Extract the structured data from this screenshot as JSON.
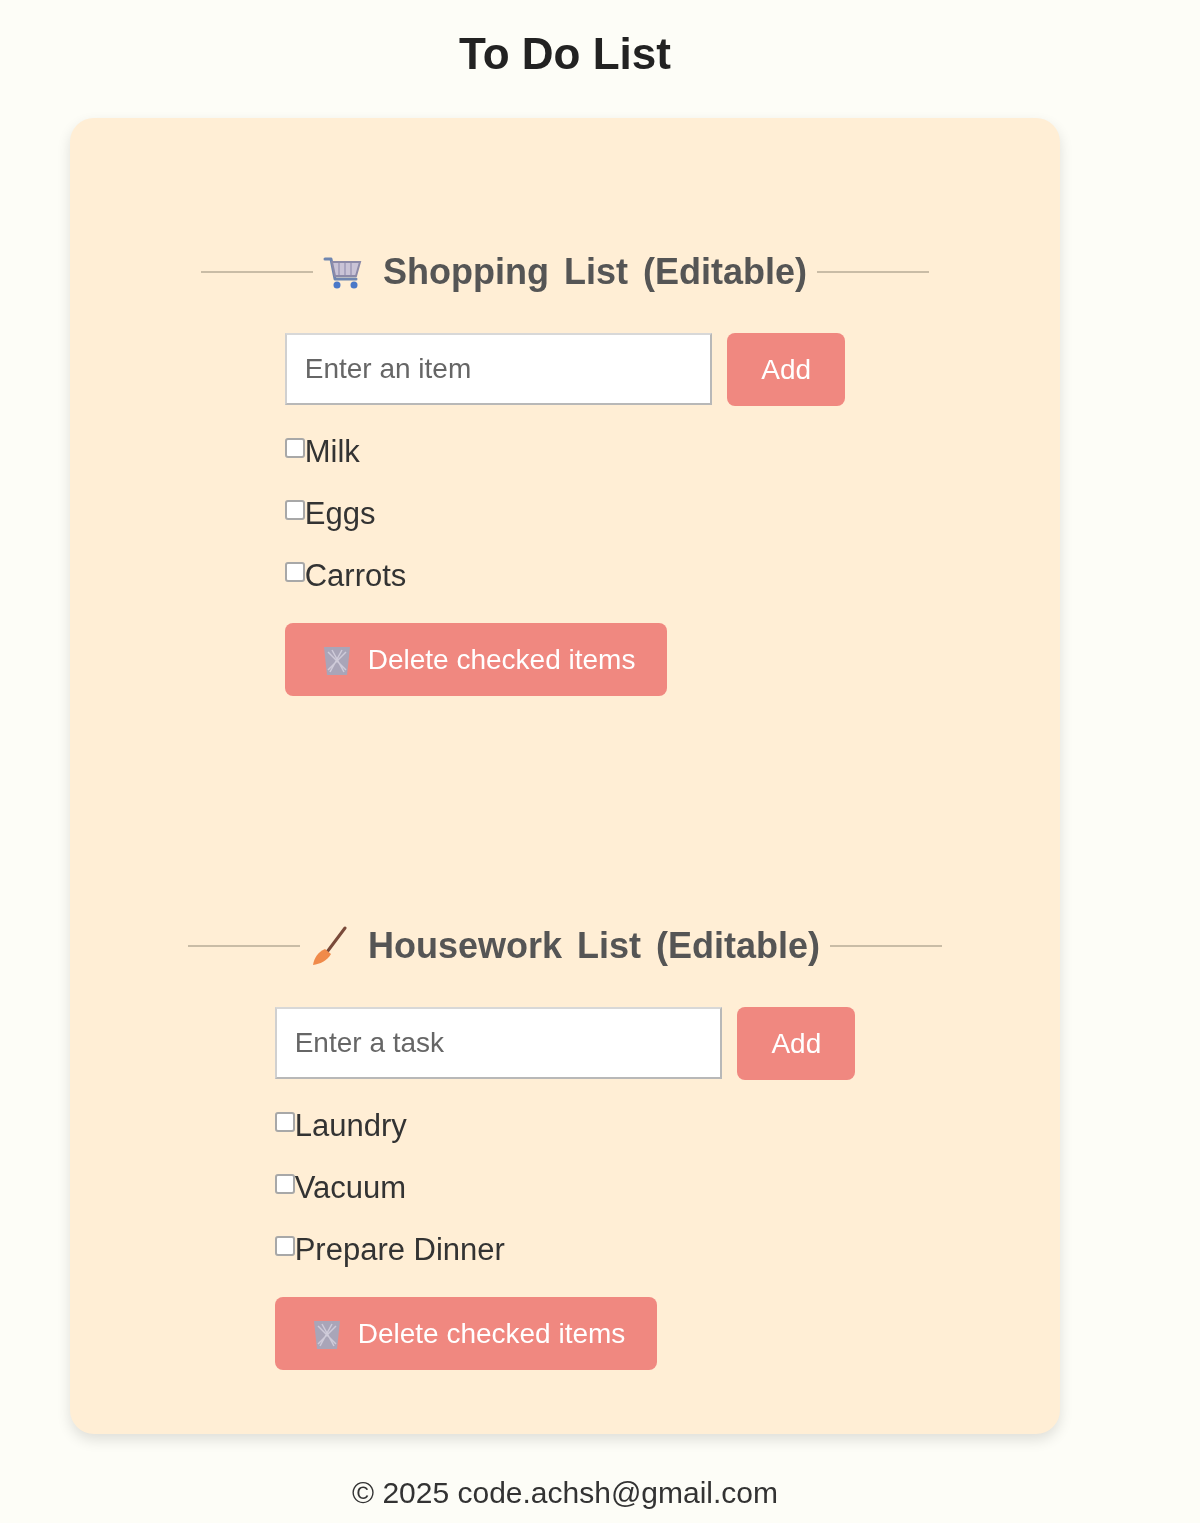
{
  "page": {
    "title": "To Do List"
  },
  "lists": [
    {
      "kind": "shopping",
      "title": "Shopping List (Editable)",
      "input": {
        "placeholder": "Enter an item"
      },
      "add_button": "Add",
      "items": [
        {
          "label": "Milk",
          "checked": false
        },
        {
          "label": "Eggs",
          "checked": false
        },
        {
          "label": "Carrots",
          "checked": false
        }
      ],
      "delete_button": "Delete checked items"
    },
    {
      "kind": "housework",
      "title": "Housework List (Editable)",
      "input": {
        "placeholder": "Enter a task"
      },
      "add_button": "Add",
      "items": [
        {
          "label": "Laundry",
          "checked": false
        },
        {
          "label": "Vacuum",
          "checked": false
        },
        {
          "label": "Prepare Dinner",
          "checked": false
        }
      ],
      "delete_button": "Delete checked items"
    }
  ],
  "footer": "© 2025 code.achsh@gmail.com"
}
